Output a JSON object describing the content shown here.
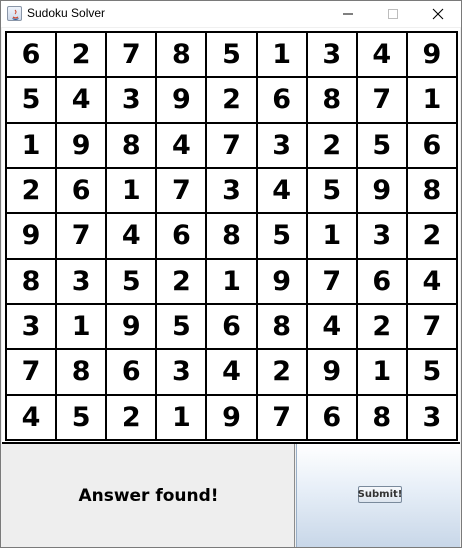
{
  "window": {
    "title": "Sudoku Solver",
    "controls": [
      "minimize",
      "maximize",
      "close"
    ]
  },
  "board": {
    "rows": [
      [
        6,
        2,
        7,
        8,
        5,
        1,
        3,
        4,
        9
      ],
      [
        5,
        4,
        3,
        9,
        2,
        6,
        8,
        7,
        1
      ],
      [
        1,
        9,
        8,
        4,
        7,
        3,
        2,
        5,
        6
      ],
      [
        2,
        6,
        1,
        7,
        3,
        4,
        5,
        9,
        8
      ],
      [
        9,
        7,
        4,
        6,
        8,
        5,
        1,
        3,
        2
      ],
      [
        8,
        3,
        5,
        2,
        1,
        9,
        7,
        6,
        4
      ],
      [
        3,
        1,
        9,
        5,
        6,
        8,
        4,
        2,
        7
      ],
      [
        7,
        8,
        6,
        3,
        4,
        2,
        9,
        1,
        5
      ],
      [
        4,
        5,
        2,
        1,
        9,
        7,
        6,
        8,
        3
      ]
    ]
  },
  "status": {
    "text": "Answer found!"
  },
  "submit": {
    "label": "Submit!"
  }
}
